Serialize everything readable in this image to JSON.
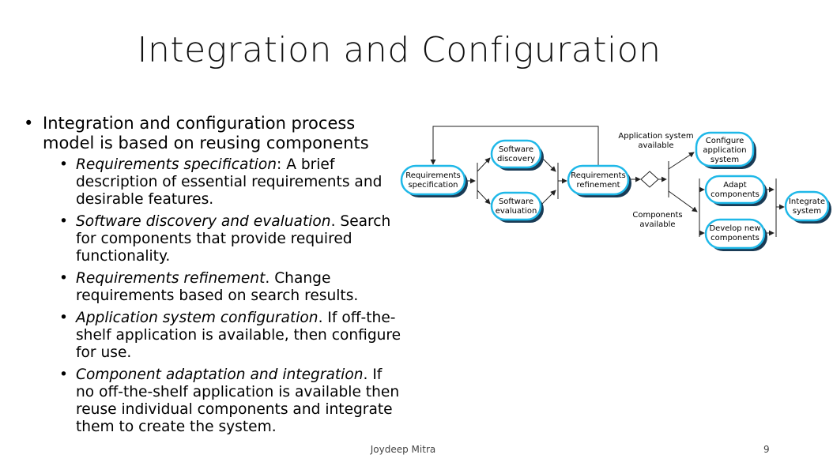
{
  "title": "Integration and Configuration",
  "main_bullet": "Integration and configuration process model is based on reusing components",
  "sub_bullets": [
    {
      "term": "Requirements specification",
      "sep": ": ",
      "text": "A brief description of essential requirements and desirable features."
    },
    {
      "term": "Software discovery and evaluation",
      "sep": ". ",
      "text": "Search for components that provide required functionality."
    },
    {
      "term": "Requirements refinement",
      "sep": ". ",
      "text": "Change requirements based on search results."
    },
    {
      "term": "Application system configuration",
      "sep": ". ",
      "text": "If off-the-shelf application is available, then configure for use."
    },
    {
      "term": "Component adaptation and integration",
      "sep": ". ",
      "text": "If no off-the-shelf application is available then reuse individual components and integrate them to create the system."
    }
  ],
  "diagram": {
    "nodes": {
      "req_spec": [
        "Requirements",
        "specification"
      ],
      "sw_discovery": [
        "Software",
        "discovery"
      ],
      "sw_evaluation": [
        "Software",
        "evaluation"
      ],
      "req_refinement": [
        "Requirements",
        "refinement"
      ],
      "configure_app": [
        "Configure",
        "application",
        "system"
      ],
      "adapt_components": [
        "Adapt",
        "components"
      ],
      "develop_components": [
        "Develop new",
        "components"
      ],
      "integrate_system": [
        "Integrate",
        "system"
      ]
    },
    "labels": {
      "app_available": [
        "Application system",
        "available"
      ],
      "components_available": [
        "Components",
        "available"
      ]
    }
  },
  "footer": {
    "author": "Joydeep Mitra",
    "page": "9"
  }
}
